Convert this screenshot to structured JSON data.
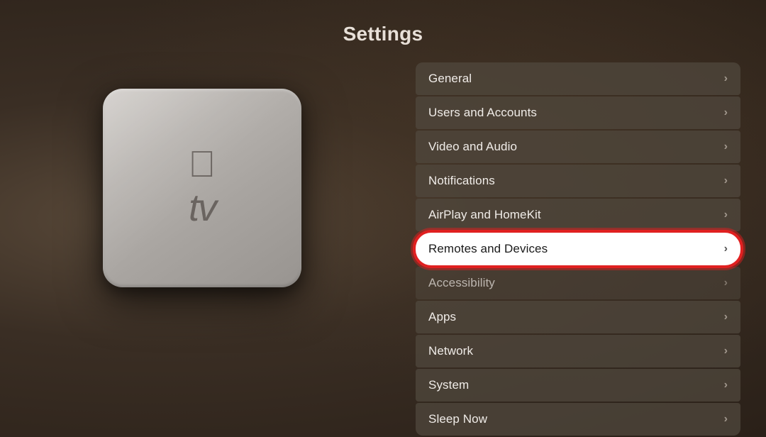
{
  "page": {
    "title": "Settings"
  },
  "settings": {
    "items": [
      {
        "id": "general",
        "label": "General",
        "highlighted": false,
        "dim": false
      },
      {
        "id": "users-and-accounts",
        "label": "Users and Accounts",
        "highlighted": false,
        "dim": false
      },
      {
        "id": "video-and-audio",
        "label": "Video and Audio",
        "highlighted": false,
        "dim": false
      },
      {
        "id": "notifications",
        "label": "Notifications",
        "highlighted": false,
        "dim": false
      },
      {
        "id": "airplay-and-homekit",
        "label": "AirPlay and HomeKit",
        "highlighted": false,
        "dim": false
      },
      {
        "id": "remotes-and-devices",
        "label": "Remotes and Devices",
        "highlighted": true,
        "dim": false
      },
      {
        "id": "accessibility",
        "label": "Accessibility",
        "highlighted": false,
        "dim": true
      },
      {
        "id": "apps",
        "label": "Apps",
        "highlighted": false,
        "dim": false
      },
      {
        "id": "network",
        "label": "Network",
        "highlighted": false,
        "dim": false
      },
      {
        "id": "system",
        "label": "System",
        "highlighted": false,
        "dim": false
      },
      {
        "id": "sleep-now",
        "label": "Sleep Now",
        "highlighted": false,
        "dim": false
      }
    ]
  },
  "device": {
    "apple_logo": "",
    "tv_text": "tv"
  }
}
